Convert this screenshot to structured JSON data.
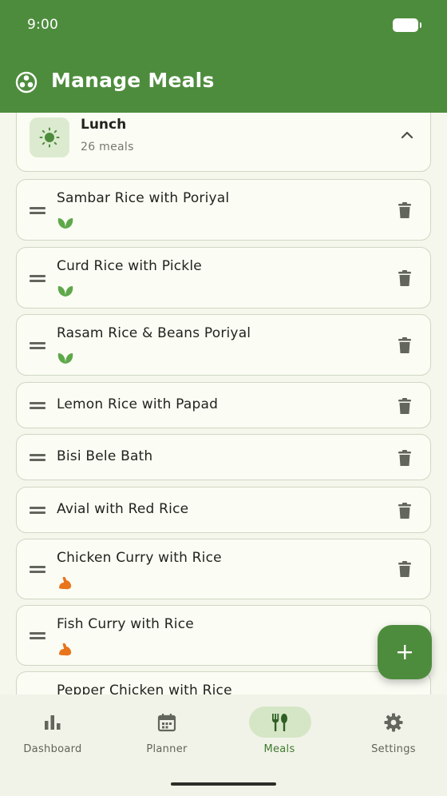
{
  "status_bar": {
    "time": "9:00"
  },
  "app_bar": {
    "title": "Manage Meals",
    "logo_icon": "bowl-logo-icon"
  },
  "section": {
    "title": "Lunch",
    "count": "26 meals",
    "icon": "sun-icon",
    "expanded": true
  },
  "meals": [
    {
      "name": "Sambar Rice with Poriyal",
      "tag": "vegetarian-leaf-icon"
    },
    {
      "name": "Curd Rice with Pickle",
      "tag": "vegetarian-leaf-icon"
    },
    {
      "name": "Rasam Rice & Beans Poriyal",
      "tag": "vegetarian-leaf-icon"
    },
    {
      "name": "Lemon Rice with Papad",
      "tag": null
    },
    {
      "name": "Bisi Bele Bath",
      "tag": null
    },
    {
      "name": "Avial with Red Rice",
      "tag": null
    },
    {
      "name": "Chicken Curry with Rice",
      "tag": "protein-arm-icon"
    },
    {
      "name": "Fish Curry with Rice",
      "tag": "protein-arm-icon"
    },
    {
      "name": "Pepper Chicken with Rice",
      "tag": null
    }
  ],
  "nav": [
    {
      "label": "Dashboard",
      "icon": "bar-chart-icon",
      "active": false
    },
    {
      "label": "Planner",
      "icon": "calendar-icon",
      "active": false
    },
    {
      "label": "Meals",
      "icon": "fork-spoon-icon",
      "active": true
    },
    {
      "label": "Settings",
      "icon": "gear-icon",
      "active": false
    }
  ],
  "colors": {
    "primary": "#4e8c3d",
    "veg": "#5ea84a",
    "protein": "#e8741c"
  }
}
